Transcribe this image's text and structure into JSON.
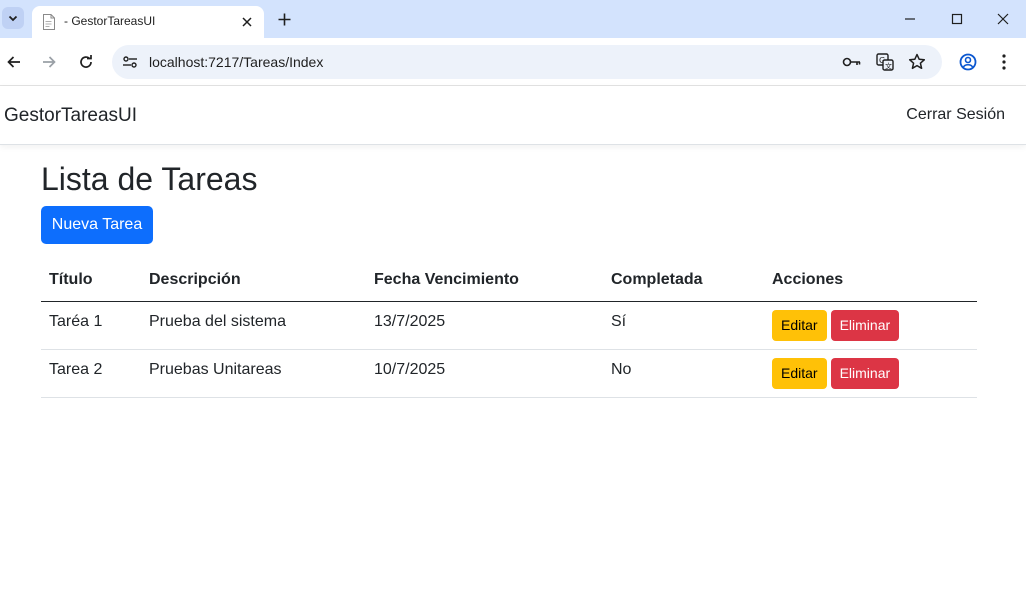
{
  "browser": {
    "tab_title": "- GestorTareasUI",
    "url": "localhost:7217/Tareas/Index"
  },
  "navbar": {
    "brand": "GestorTareasUI",
    "logout": "Cerrar Sesión"
  },
  "main": {
    "title": "Lista de Tareas",
    "new_button": "Nueva Tarea",
    "table": {
      "headers": [
        "Título",
        "Descripción",
        "Fecha Vencimiento",
        "Completada",
        "Acciones"
      ],
      "rows": [
        {
          "titulo": "Taréa 1",
          "descripcion": "Prueba del sistema",
          "fecha": "13/7/2025",
          "completada": "Sí",
          "edit": "Editar",
          "delete": "Eliminar"
        },
        {
          "titulo": "Tarea 2",
          "descripcion": "Pruebas Unitareas",
          "fecha": "10/7/2025",
          "completada": "No",
          "edit": "Editar",
          "delete": "Eliminar"
        }
      ]
    }
  },
  "colors": {
    "primary": "#0d6efd",
    "warning": "#ffc107",
    "danger": "#dc3545",
    "chrome_tabstrip": "#d3e3fd",
    "omnibox": "#edf2fa"
  }
}
